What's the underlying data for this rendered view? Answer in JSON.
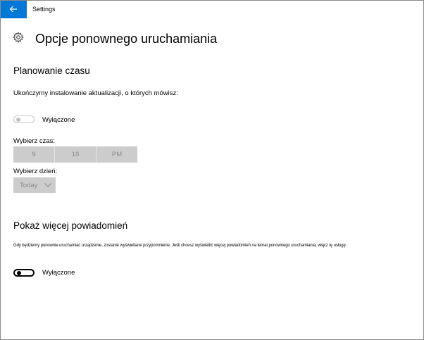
{
  "window": {
    "app_title": "Settings",
    "back_icon": "arrow-left-icon",
    "accent_color": "#0078d7"
  },
  "page": {
    "icon": "gear-icon",
    "title": "Opcje ponownego uruchamiania"
  },
  "schedule": {
    "heading": "Planowanie czasu",
    "description": "Ukończymy instalowanie aktualizacji, o których mówisz:",
    "toggle": {
      "state": "off",
      "enabled": false,
      "label": "Wyłączone"
    },
    "time_label": "Wybierz czas:",
    "time": {
      "hour": "9",
      "minute": "18",
      "period": "PM"
    },
    "day_label": "Wybierz dzień:",
    "day_value": "Today",
    "day_icon": "chevron-down-icon"
  },
  "notifications": {
    "heading": "Pokaż więcej powiadomień",
    "description": "Gdy będziemy ponownie uruchamiać urządzenie, zostanie wyświetlane przypomnienie. Jeśli chcesz wyświetlić więcej powiadomień na temat ponownego uruchamiania, włącz tę usługę.",
    "toggle": {
      "state": "off",
      "enabled": true,
      "label": "Wyłączone"
    }
  }
}
